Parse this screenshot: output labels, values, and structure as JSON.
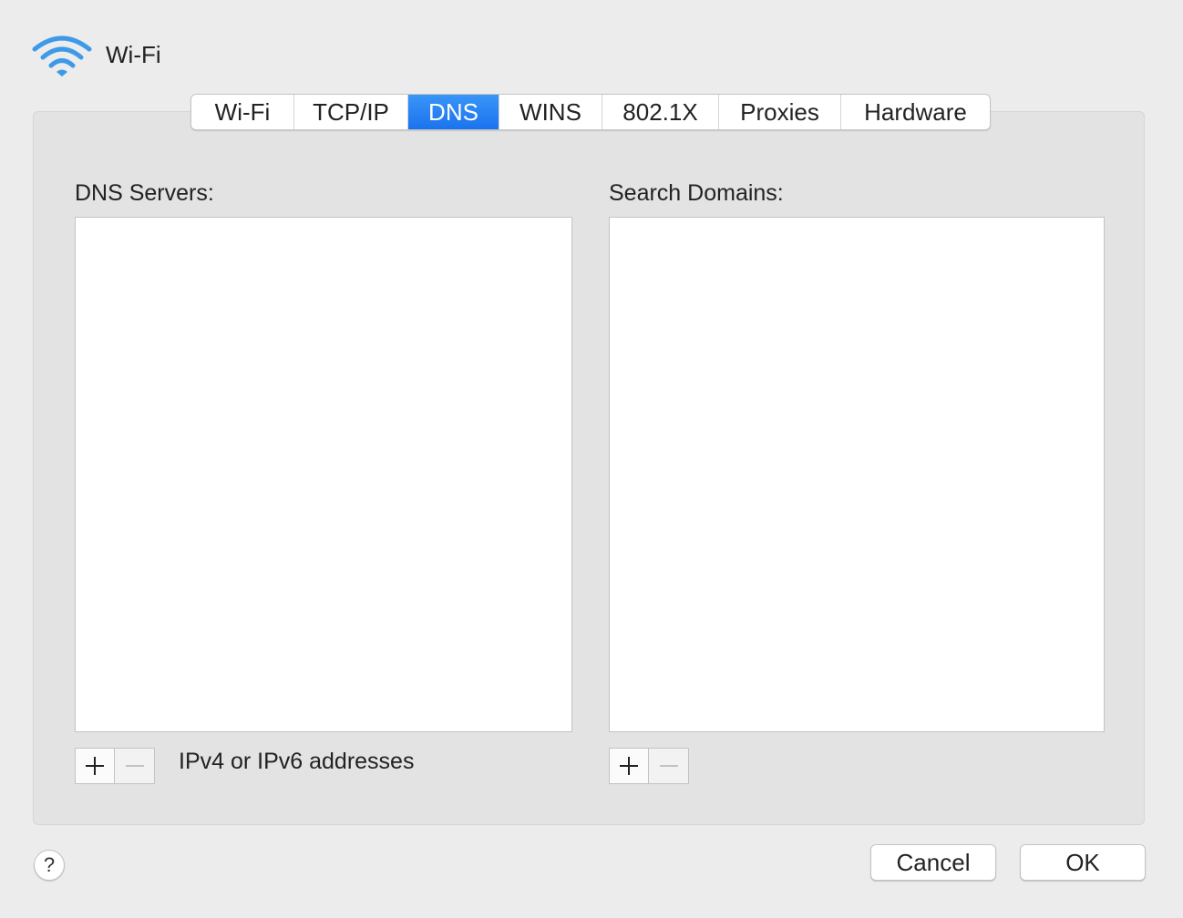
{
  "header": {
    "title": "Wi-Fi",
    "icon": "wifi-icon",
    "accent_color": "#3d9ae8"
  },
  "tabs": [
    {
      "label": "Wi-Fi",
      "active": false
    },
    {
      "label": "TCP/IP",
      "active": false
    },
    {
      "label": "DNS",
      "active": true
    },
    {
      "label": "WINS",
      "active": false
    },
    {
      "label": "802.1X",
      "active": false
    },
    {
      "label": "Proxies",
      "active": false
    },
    {
      "label": "Hardware",
      "active": false
    }
  ],
  "dns_servers": {
    "label": "DNS Servers:",
    "items": [],
    "add_icon": "plus-icon",
    "remove_icon": "minus-icon",
    "hint": "IPv4 or IPv6 addresses"
  },
  "search_domains": {
    "label": "Search Domains:",
    "items": [],
    "add_icon": "plus-icon",
    "remove_icon": "minus-icon"
  },
  "footer": {
    "help_label": "?",
    "cancel_label": "Cancel",
    "ok_label": "OK"
  }
}
